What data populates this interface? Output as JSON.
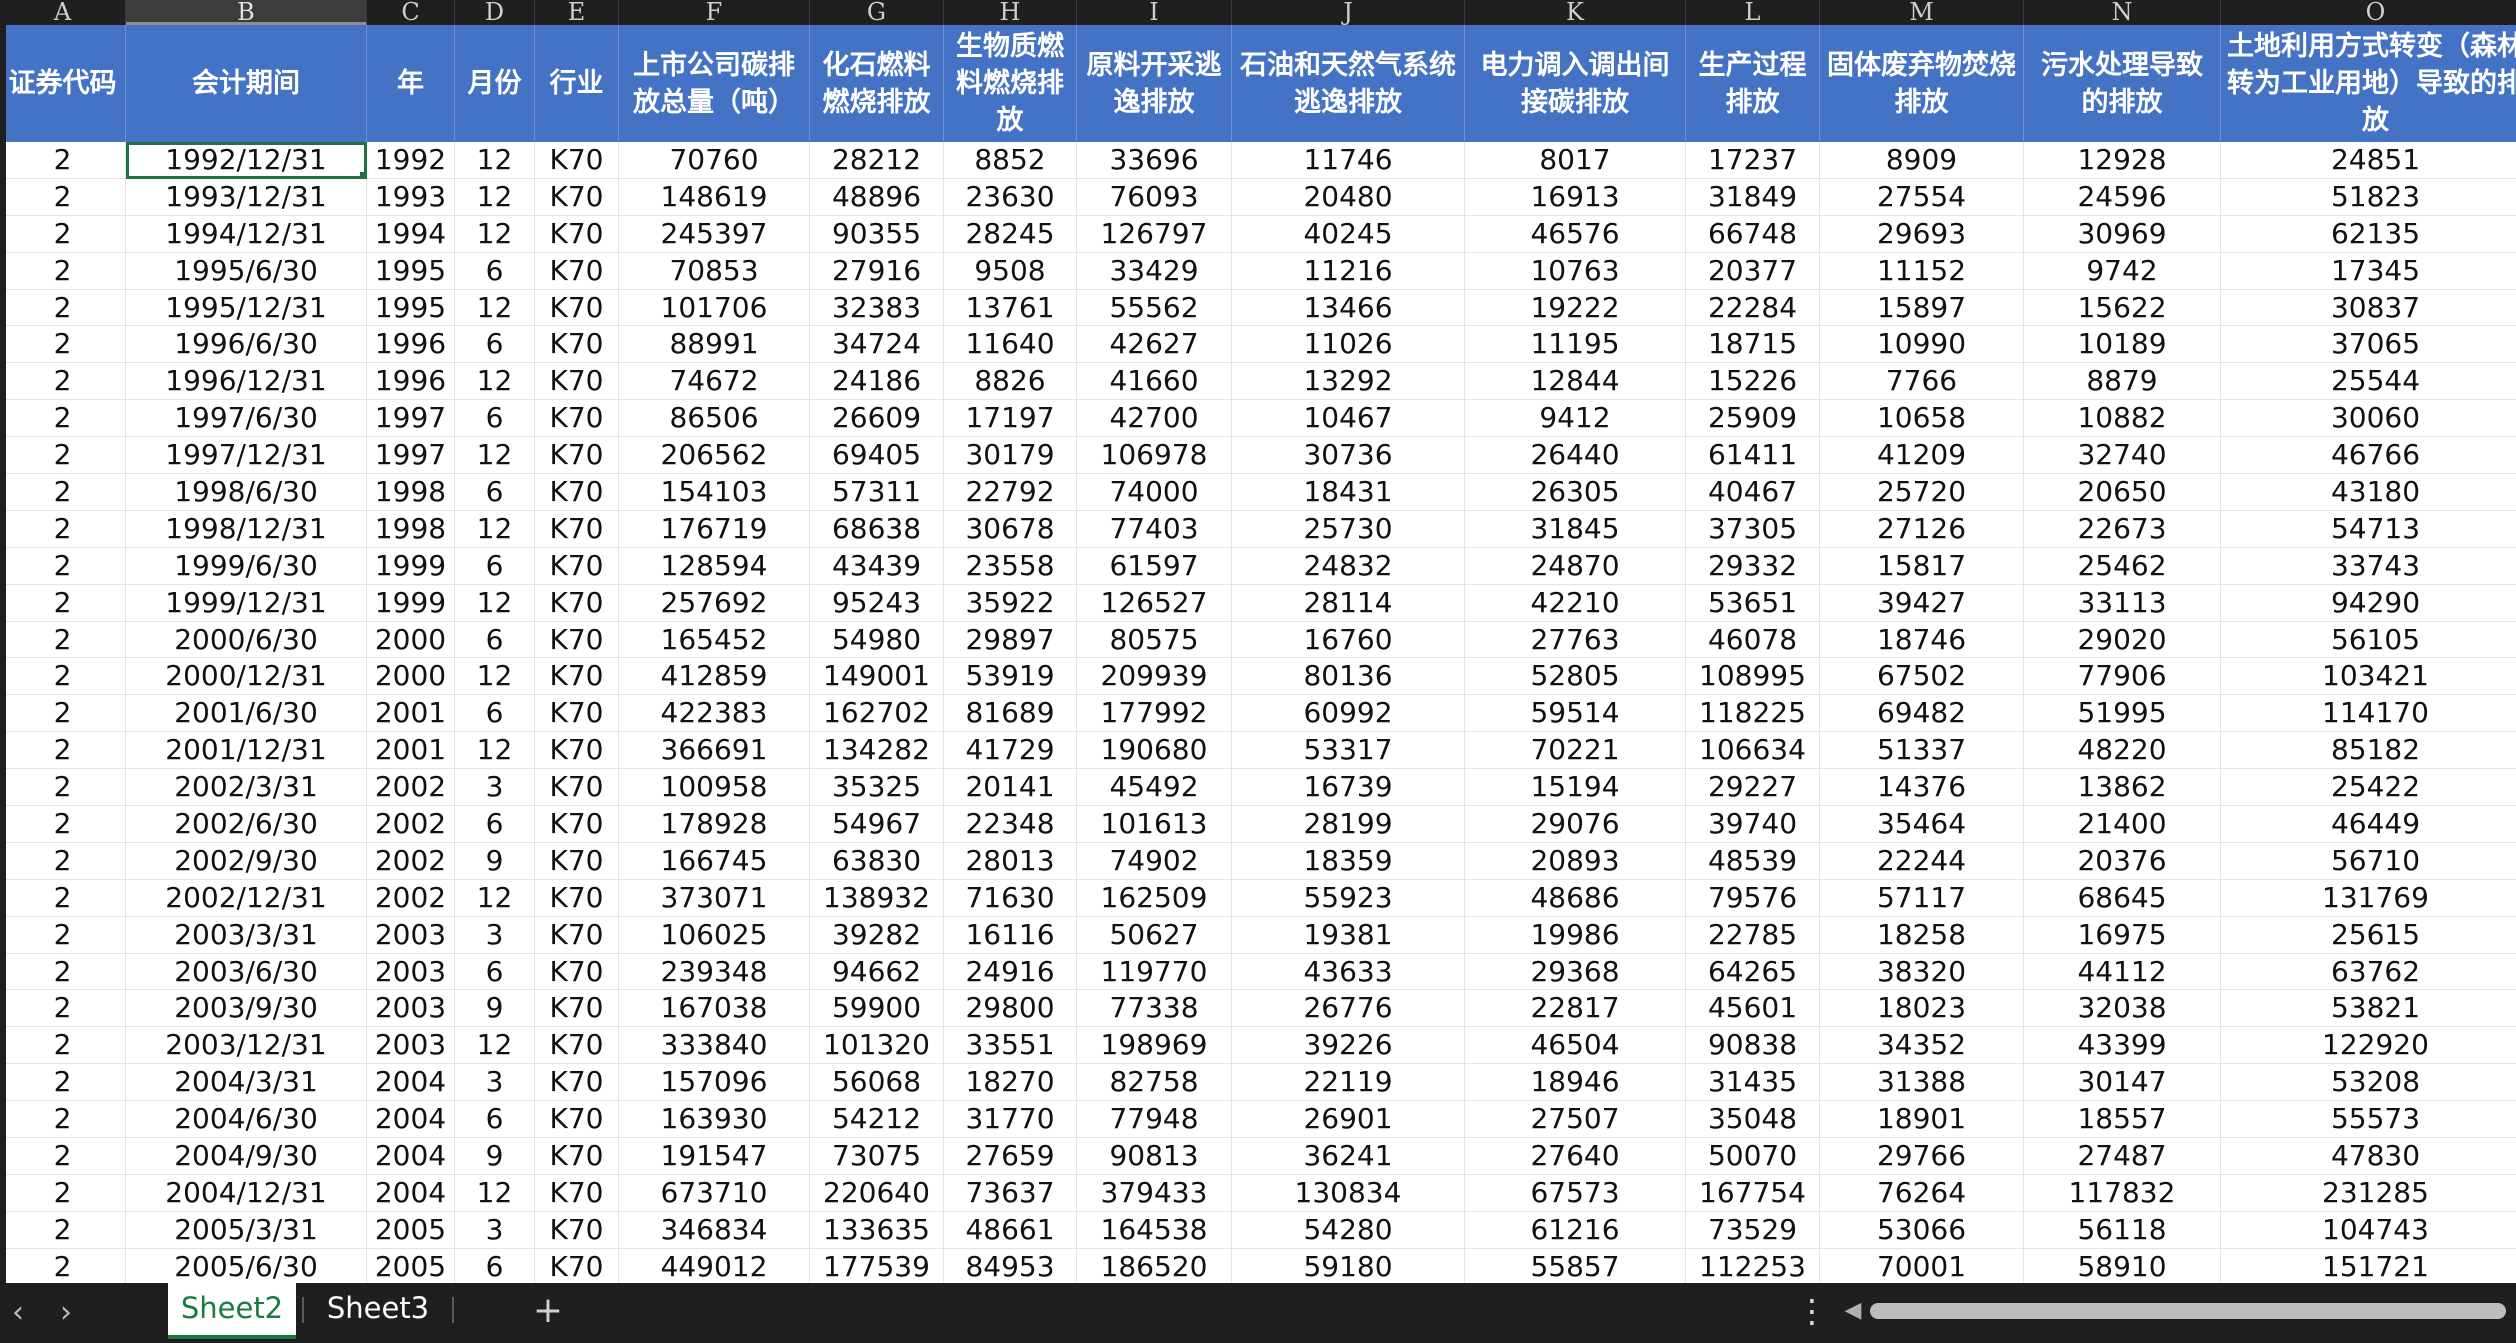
{
  "columns": {
    "letters": [
      "A",
      "B",
      "C",
      "D",
      "E",
      "F",
      "G",
      "H",
      "I",
      "J",
      "K",
      "L",
      "M",
      "N",
      "O"
    ],
    "headers": [
      "证券代码",
      "会计期间",
      "年",
      "月份",
      "行业",
      "上市公司碳排放总量（吨）",
      "化石燃料燃烧排放",
      "生物质燃料燃烧排放",
      "原料开采逃逸排放",
      "石油和天然气系统逃逸排放",
      "电力调入调出间接碳排放",
      "生产过程排放",
      "固体废弃物焚烧排放",
      "污水处理导致的排放",
      "土地利用方式转变（森林转为工业用地）导致的排放"
    ]
  },
  "rows": [
    [
      "2",
      "1992/12/31",
      "1992",
      "12",
      "K70",
      "70760",
      "28212",
      "8852",
      "33696",
      "11746",
      "8017",
      "17237",
      "8909",
      "12928",
      "24851"
    ],
    [
      "2",
      "1993/12/31",
      "1993",
      "12",
      "K70",
      "148619",
      "48896",
      "23630",
      "76093",
      "20480",
      "16913",
      "31849",
      "27554",
      "24596",
      "51823"
    ],
    [
      "2",
      "1994/12/31",
      "1994",
      "12",
      "K70",
      "245397",
      "90355",
      "28245",
      "126797",
      "40245",
      "46576",
      "66748",
      "29693",
      "30969",
      "62135"
    ],
    [
      "2",
      "1995/6/30",
      "1995",
      "6",
      "K70",
      "70853",
      "27916",
      "9508",
      "33429",
      "11216",
      "10763",
      "20377",
      "11152",
      "9742",
      "17345"
    ],
    [
      "2",
      "1995/12/31",
      "1995",
      "12",
      "K70",
      "101706",
      "32383",
      "13761",
      "55562",
      "13466",
      "19222",
      "22284",
      "15897",
      "15622",
      "30837"
    ],
    [
      "2",
      "1996/6/30",
      "1996",
      "6",
      "K70",
      "88991",
      "34724",
      "11640",
      "42627",
      "11026",
      "11195",
      "18715",
      "10990",
      "10189",
      "37065"
    ],
    [
      "2",
      "1996/12/31",
      "1996",
      "12",
      "K70",
      "74672",
      "24186",
      "8826",
      "41660",
      "13292",
      "12844",
      "15226",
      "7766",
      "8879",
      "25544"
    ],
    [
      "2",
      "1997/6/30",
      "1997",
      "6",
      "K70",
      "86506",
      "26609",
      "17197",
      "42700",
      "10467",
      "9412",
      "25909",
      "10658",
      "10882",
      "30060"
    ],
    [
      "2",
      "1997/12/31",
      "1997",
      "12",
      "K70",
      "206562",
      "69405",
      "30179",
      "106978",
      "30736",
      "26440",
      "61411",
      "41209",
      "32740",
      "46766"
    ],
    [
      "2",
      "1998/6/30",
      "1998",
      "6",
      "K70",
      "154103",
      "57311",
      "22792",
      "74000",
      "18431",
      "26305",
      "40467",
      "25720",
      "20650",
      "43180"
    ],
    [
      "2",
      "1998/12/31",
      "1998",
      "12",
      "K70",
      "176719",
      "68638",
      "30678",
      "77403",
      "25730",
      "31845",
      "37305",
      "27126",
      "22673",
      "54713"
    ],
    [
      "2",
      "1999/6/30",
      "1999",
      "6",
      "K70",
      "128594",
      "43439",
      "23558",
      "61597",
      "24832",
      "24870",
      "29332",
      "15817",
      "25462",
      "33743"
    ],
    [
      "2",
      "1999/12/31",
      "1999",
      "12",
      "K70",
      "257692",
      "95243",
      "35922",
      "126527",
      "28114",
      "42210",
      "53651",
      "39427",
      "33113",
      "94290"
    ],
    [
      "2",
      "2000/6/30",
      "2000",
      "6",
      "K70",
      "165452",
      "54980",
      "29897",
      "80575",
      "16760",
      "27763",
      "46078",
      "18746",
      "29020",
      "56105"
    ],
    [
      "2",
      "2000/12/31",
      "2000",
      "12",
      "K70",
      "412859",
      "149001",
      "53919",
      "209939",
      "80136",
      "52805",
      "108995",
      "67502",
      "77906",
      "103421"
    ],
    [
      "2",
      "2001/6/30",
      "2001",
      "6",
      "K70",
      "422383",
      "162702",
      "81689",
      "177992",
      "60992",
      "59514",
      "118225",
      "69482",
      "51995",
      "114170"
    ],
    [
      "2",
      "2001/12/31",
      "2001",
      "12",
      "K70",
      "366691",
      "134282",
      "41729",
      "190680",
      "53317",
      "70221",
      "106634",
      "51337",
      "48220",
      "85182"
    ],
    [
      "2",
      "2002/3/31",
      "2002",
      "3",
      "K70",
      "100958",
      "35325",
      "20141",
      "45492",
      "16739",
      "15194",
      "29227",
      "14376",
      "13862",
      "25422"
    ],
    [
      "2",
      "2002/6/30",
      "2002",
      "6",
      "K70",
      "178928",
      "54967",
      "22348",
      "101613",
      "28199",
      "29076",
      "39740",
      "35464",
      "21400",
      "46449"
    ],
    [
      "2",
      "2002/9/30",
      "2002",
      "9",
      "K70",
      "166745",
      "63830",
      "28013",
      "74902",
      "18359",
      "20893",
      "48539",
      "22244",
      "20376",
      "56710"
    ],
    [
      "2",
      "2002/12/31",
      "2002",
      "12",
      "K70",
      "373071",
      "138932",
      "71630",
      "162509",
      "55923",
      "48686",
      "79576",
      "57117",
      "68645",
      "131769"
    ],
    [
      "2",
      "2003/3/31",
      "2003",
      "3",
      "K70",
      "106025",
      "39282",
      "16116",
      "50627",
      "19381",
      "19986",
      "22785",
      "18258",
      "16975",
      "25615"
    ],
    [
      "2",
      "2003/6/30",
      "2003",
      "6",
      "K70",
      "239348",
      "94662",
      "24916",
      "119770",
      "43633",
      "29368",
      "64265",
      "38320",
      "44112",
      "63762"
    ],
    [
      "2",
      "2003/9/30",
      "2003",
      "9",
      "K70",
      "167038",
      "59900",
      "29800",
      "77338",
      "26776",
      "22817",
      "45601",
      "18023",
      "32038",
      "53821"
    ],
    [
      "2",
      "2003/12/31",
      "2003",
      "12",
      "K70",
      "333840",
      "101320",
      "33551",
      "198969",
      "39226",
      "46504",
      "90838",
      "34352",
      "43399",
      "122920"
    ],
    [
      "2",
      "2004/3/31",
      "2004",
      "3",
      "K70",
      "157096",
      "56068",
      "18270",
      "82758",
      "22119",
      "18946",
      "31435",
      "31388",
      "30147",
      "53208"
    ],
    [
      "2",
      "2004/6/30",
      "2004",
      "6",
      "K70",
      "163930",
      "54212",
      "31770",
      "77948",
      "26901",
      "27507",
      "35048",
      "18901",
      "18557",
      "55573"
    ],
    [
      "2",
      "2004/9/30",
      "2004",
      "9",
      "K70",
      "191547",
      "73075",
      "27659",
      "90813",
      "36241",
      "27640",
      "50070",
      "29766",
      "27487",
      "47830"
    ],
    [
      "2",
      "2004/12/31",
      "2004",
      "12",
      "K70",
      "673710",
      "220640",
      "73637",
      "379433",
      "130834",
      "67573",
      "167754",
      "76264",
      "117832",
      "231285"
    ],
    [
      "2",
      "2005/3/31",
      "2005",
      "3",
      "K70",
      "346834",
      "133635",
      "48661",
      "164538",
      "54280",
      "61216",
      "73529",
      "53066",
      "56118",
      "104743"
    ],
    [
      "2",
      "2005/6/30",
      "2005",
      "6",
      "K70",
      "449012",
      "177539",
      "84953",
      "186520",
      "59180",
      "55857",
      "112253",
      "70001",
      "58910",
      "151721"
    ]
  ],
  "tabs": {
    "sheets": [
      "Sheet2",
      "Sheet3"
    ],
    "active": "Sheet2"
  },
  "icons": {
    "prev": "chevron-left-icon",
    "next": "chevron-right-icon",
    "add": "plus-icon",
    "more": "vertical-ellipsis-icon",
    "scroll_left": "triangle-left-icon"
  },
  "colors": {
    "header_bg": "#4472c4",
    "active_tab": "#1a7a3f",
    "selection": "#217346"
  }
}
